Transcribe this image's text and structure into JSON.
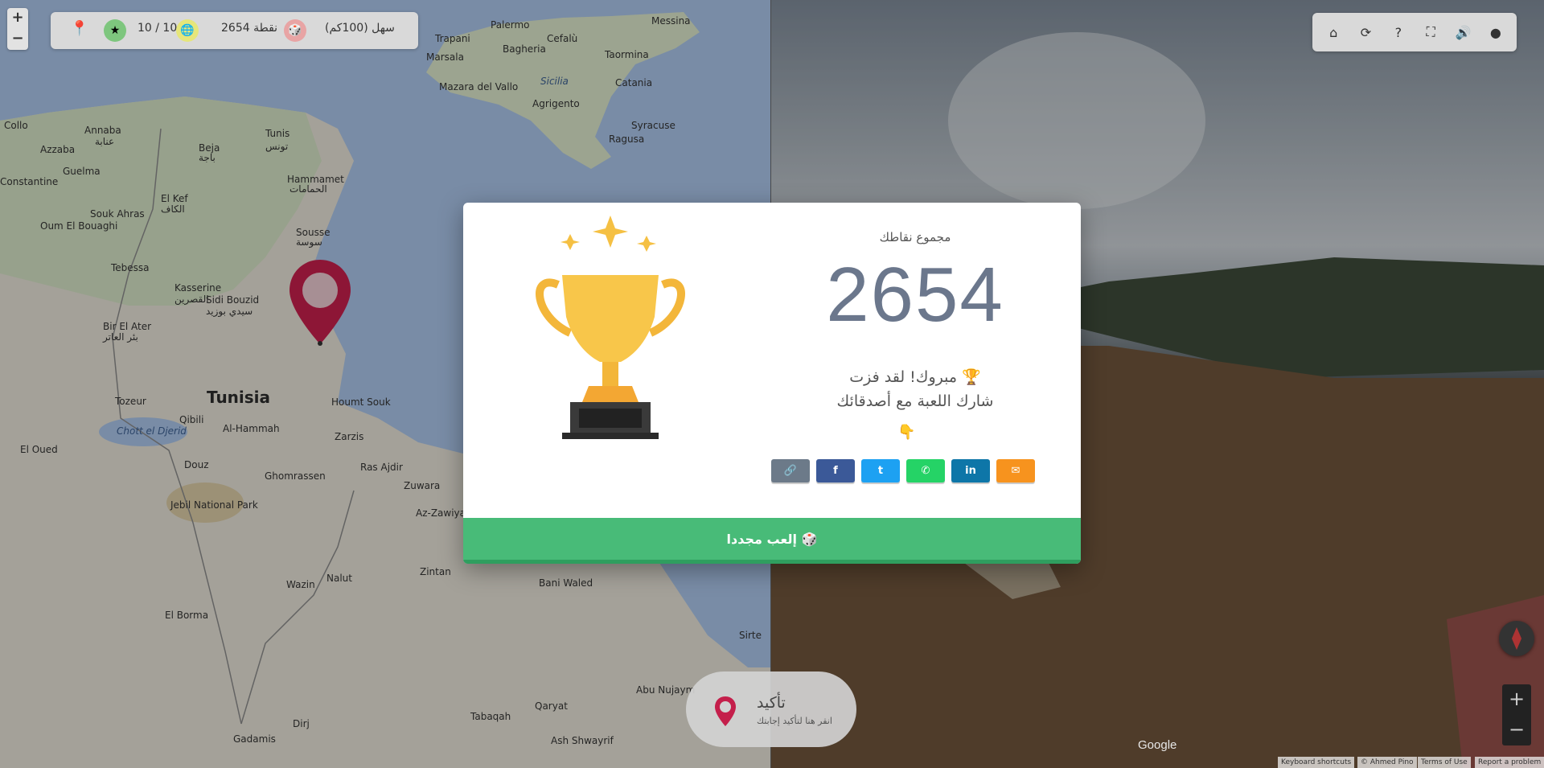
{
  "hud": {
    "difficulty": "سهل (100كم)",
    "points": "2654 نقطة",
    "rounds": "10 / 10"
  },
  "zoom": {
    "plus": "+",
    "minus": "−"
  },
  "map_labels": [
    {
      "text": "Palermo",
      "cls": ""
    },
    {
      "text": "Messina",
      "cls": ""
    },
    {
      "text": "Trapani",
      "cls": ""
    },
    {
      "text": "Bagheria",
      "cls": ""
    },
    {
      "text": "Cefalù",
      "cls": ""
    },
    {
      "text": "Marsala",
      "cls": ""
    },
    {
      "text": "Taormina",
      "cls": ""
    },
    {
      "text": "Sicilia",
      "cls": "sea"
    },
    {
      "text": "Catania",
      "cls": ""
    },
    {
      "text": "Mazara del Vallo",
      "cls": ""
    },
    {
      "text": "Agrigento",
      "cls": ""
    },
    {
      "text": "Syracuse",
      "cls": ""
    },
    {
      "text": "Ragusa",
      "cls": ""
    },
    {
      "text": "Annaba",
      "cls": ""
    },
    {
      "text": "عنابة",
      "cls": ""
    },
    {
      "text": "Tunis",
      "cls": ""
    },
    {
      "text": "تونس",
      "cls": ""
    },
    {
      "text": "Beja",
      "cls": ""
    },
    {
      "text": "باجة",
      "cls": ""
    },
    {
      "text": "Guelma",
      "cls": ""
    },
    {
      "text": "Hammamet",
      "cls": ""
    },
    {
      "text": "الحمامات",
      "cls": ""
    },
    {
      "text": "Constantine",
      "cls": ""
    },
    {
      "text": "El Kef",
      "cls": ""
    },
    {
      "text": "الكاف",
      "cls": ""
    },
    {
      "text": "Souk Ahras",
      "cls": ""
    },
    {
      "text": "Sousse",
      "cls": ""
    },
    {
      "text": "سوسة",
      "cls": ""
    },
    {
      "text": "Oum El Bouaghi",
      "cls": ""
    },
    {
      "text": "Tebessa",
      "cls": ""
    },
    {
      "text": "Kasserine",
      "cls": ""
    },
    {
      "text": "القصرين",
      "cls": ""
    },
    {
      "text": "Sidi Bouzid",
      "cls": ""
    },
    {
      "text": "سيدي بوزيد",
      "cls": ""
    },
    {
      "text": "Bir El Ater",
      "cls": ""
    },
    {
      "text": "بئر العاتر",
      "cls": ""
    },
    {
      "text": "Tunisia",
      "cls": "big"
    },
    {
      "text": "Tozeur",
      "cls": ""
    },
    {
      "text": "Chott el Djerid",
      "cls": "sea"
    },
    {
      "text": "Qibili",
      "cls": ""
    },
    {
      "text": "Al-Hammah",
      "cls": ""
    },
    {
      "text": "Houmt Souk",
      "cls": ""
    },
    {
      "text": "Zarzis",
      "cls": ""
    },
    {
      "text": "El Oued",
      "cls": ""
    },
    {
      "text": "Douz",
      "cls": ""
    },
    {
      "text": "Ghomrassen",
      "cls": ""
    },
    {
      "text": "Ras Ajdir",
      "cls": ""
    },
    {
      "text": "Zuwara",
      "cls": ""
    },
    {
      "text": "Jebil National Park",
      "cls": ""
    },
    {
      "text": "Az-Zawiyah",
      "cls": ""
    },
    {
      "text": "Nalut",
      "cls": ""
    },
    {
      "text": "Zintan",
      "cls": ""
    },
    {
      "text": "Bani Waled",
      "cls": ""
    },
    {
      "text": "Wazin",
      "cls": ""
    },
    {
      "text": "El Borma",
      "cls": ""
    },
    {
      "text": "Sirte",
      "cls": ""
    },
    {
      "text": "Abu Nujaym",
      "cls": ""
    },
    {
      "text": "Qaryat",
      "cls": ""
    },
    {
      "text": "Tabaqah",
      "cls": ""
    },
    {
      "text": "Ash Shwayrif",
      "cls": ""
    },
    {
      "text": "Dirj",
      "cls": ""
    },
    {
      "text": "Gadamis",
      "cls": ""
    },
    {
      "text": "Collo",
      "cls": ""
    },
    {
      "text": "Azzaba",
      "cls": ""
    }
  ],
  "modal": {
    "score_label": "مجموع نقاطك",
    "score": "2654",
    "congrats_line1": "مبروك! لقد فزت 🏆",
    "congrats_line2": "شارك اللعبة مع أصدقائك",
    "pointer": "👇",
    "play_again": "إلعب مجددا 🎲",
    "shares": [
      {
        "name": "copy-link",
        "icon": "🔗",
        "color": "#6c7a89"
      },
      {
        "name": "facebook",
        "icon": "f",
        "color": "#3b5998"
      },
      {
        "name": "twitter",
        "icon": "t",
        "color": "#1da1f2"
      },
      {
        "name": "whatsapp",
        "icon": "✆",
        "color": "#25d366"
      },
      {
        "name": "linkedin",
        "icon": "in",
        "color": "#0e76a8"
      },
      {
        "name": "email",
        "icon": "✉",
        "color": "#f7931e"
      }
    ]
  },
  "confirm": {
    "title": "تأكيد",
    "subtitle": "انقر هنا لتأكيد إجابتك"
  },
  "pano": {
    "google": "Google",
    "footer": [
      "Keyboard shortcuts",
      "© Ahmed Pino",
      "Terms of Use",
      "Report a problem"
    ],
    "zoom_plus": "+",
    "zoom_minus": "−"
  },
  "toolbar_icons": [
    "home-icon",
    "refresh-icon",
    "help-icon",
    "fullscreen-icon",
    "sound-icon",
    "github-icon"
  ]
}
